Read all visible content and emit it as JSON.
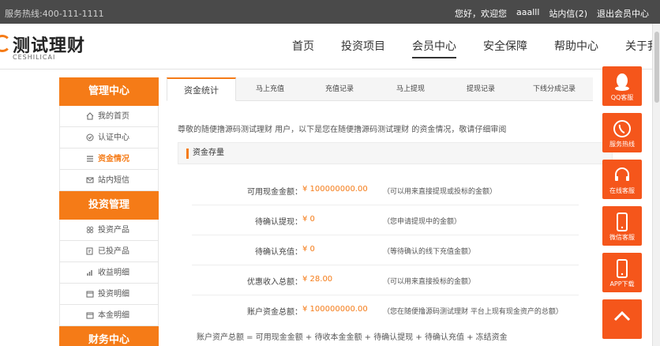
{
  "topbar": {
    "hotline": "服务热线:400-111-1111",
    "greeting": "您好，欢迎您",
    "username": "aaalll",
    "messages": "站内信(2)",
    "logout": "退出会员中心"
  },
  "header": {
    "logo_cn": "测试理财",
    "logo_en": "CESHILICAI",
    "nav": [
      {
        "label": "首页"
      },
      {
        "label": "投资项目"
      },
      {
        "label": "会员中心"
      },
      {
        "label": "安全保障"
      },
      {
        "label": "帮助中心"
      },
      {
        "label": "关于我"
      }
    ],
    "active_nav": "会员中心"
  },
  "sidebar": {
    "sections": [
      {
        "title": "管理中心",
        "items": [
          {
            "label": "我的首页",
            "icon": "home-icon"
          },
          {
            "label": "认证中心",
            "icon": "shield-check-icon"
          },
          {
            "label": "资金情况",
            "icon": "menu-lines-icon",
            "active": true
          },
          {
            "label": "站内短信",
            "icon": "mail-icon"
          }
        ]
      },
      {
        "title": "投资管理",
        "items": [
          {
            "label": "投资产品",
            "icon": "grid-icon"
          },
          {
            "label": "已投产品",
            "icon": "edit-doc-icon"
          },
          {
            "label": "收益明细",
            "icon": "bar-chart-icon"
          },
          {
            "label": "投资明细",
            "icon": "calendar-icon"
          },
          {
            "label": "本金明细",
            "icon": "calendar-icon"
          }
        ]
      },
      {
        "title": "财务中心",
        "items": []
      }
    ]
  },
  "main": {
    "tabs": [
      {
        "label": "资金统计",
        "active": true
      },
      {
        "label": "马上充值"
      },
      {
        "label": "充值记录"
      },
      {
        "label": "马上提现"
      },
      {
        "label": "提现记录"
      },
      {
        "label": "下线分成记录"
      }
    ],
    "intro": "尊敬的随便撸源码测试理财 用户，以下是您在随便撸源码测试理财 的资金情况，敬请仔细审阅",
    "panel_title": "资金存量",
    "rows": [
      {
        "label": "可用现金金额：",
        "value": "¥ 100000000.00",
        "note": "（可以用来直接提现或投标的金额）"
      },
      {
        "label": "待确认提现：",
        "value": "¥ 0",
        "note": "（您申请提现中的金额）"
      },
      {
        "label": "待确认充值：",
        "value": "¥ 0",
        "note": "（等待确认的线下充值金额）"
      },
      {
        "label": "优惠收入总额：",
        "value": "¥ 28.00",
        "note": "（可以用来直接投标的金额）"
      },
      {
        "label": "账户资金总额：",
        "value": "¥ 100000000.00",
        "note": "（您在随便撸源码测试理财 平台上现有现金资产的总额）"
      }
    ],
    "formula": "账户资产总额 = 可用现金金额 + 待收本金金额 + 待确认提现 + 待确认充值 + 冻结资金"
  },
  "float": [
    {
      "label": "QQ客服",
      "icon": "qq-icon"
    },
    {
      "label": "服务热线",
      "icon": "phone-icon"
    },
    {
      "label": "在线客服",
      "icon": "headset-icon"
    },
    {
      "label": "微信客服",
      "icon": "mobile-icon"
    },
    {
      "label": "APP下载",
      "icon": "mobile-icon"
    },
    {
      "label": "",
      "icon": "chevron-up-icon"
    }
  ],
  "colors": {
    "accent": "#f57b17",
    "float": "#f5561b",
    "topbar": "#4a4a4a"
  }
}
